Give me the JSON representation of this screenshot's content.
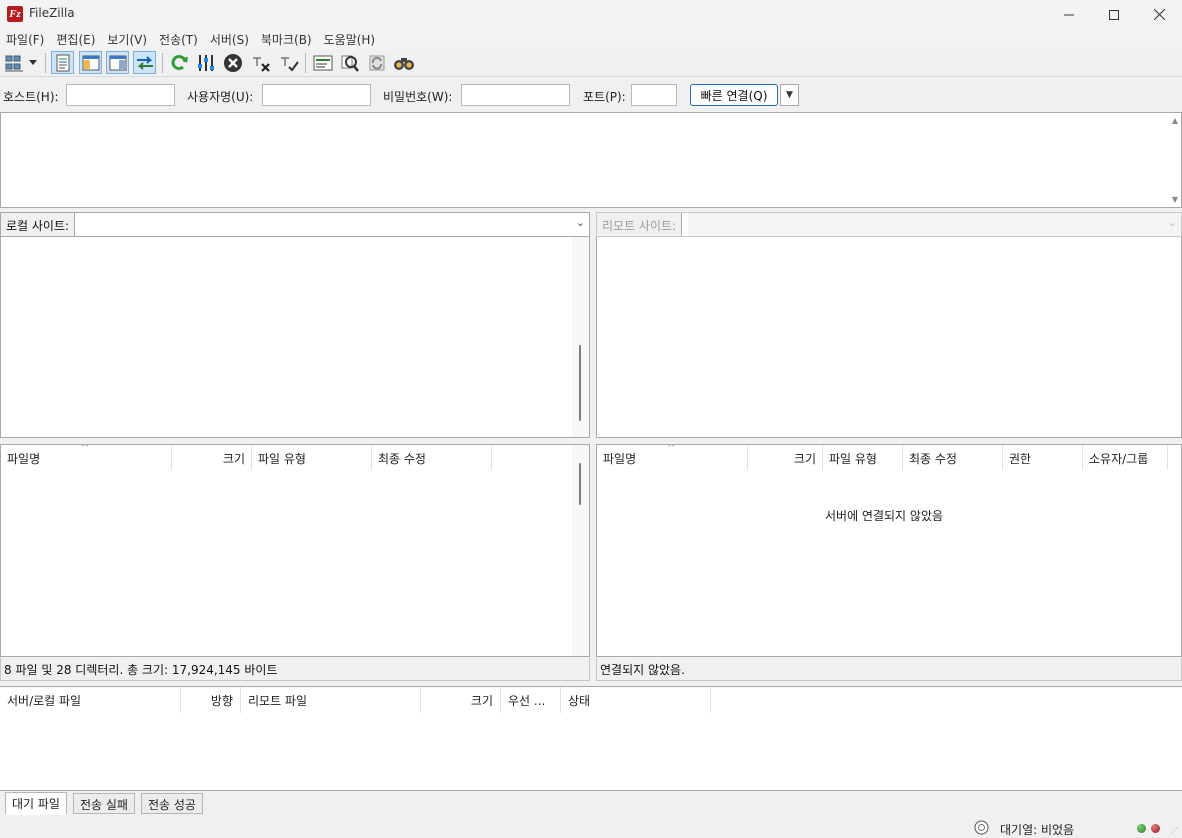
{
  "window": {
    "title": "FileZilla",
    "logo_text": "Fz"
  },
  "menu": [
    {
      "label": "파일(F)"
    },
    {
      "label": "편집(E)"
    },
    {
      "label": "보기(V)"
    },
    {
      "label": "전송(T)"
    },
    {
      "label": "서버(S)"
    },
    {
      "label": "북마크(B)"
    },
    {
      "label": "도움말(H)"
    }
  ],
  "toolbar": {
    "icons": [
      "site-manager-icon",
      "dropdown-icon",
      "toggle-log-icon",
      "toggle-local-tree-icon",
      "toggle-remote-tree-icon",
      "toggle-queue-icon",
      "refresh-icon",
      "filter-icon",
      "cancel-icon",
      "disconnect-icon",
      "reconnect-icon",
      "directory-listing-icon",
      "search-icon",
      "sync-browsing-icon",
      "find-files-icon"
    ]
  },
  "quickconnect": {
    "host_label": "호스트(H):",
    "user_label": "사용자명(U):",
    "pass_label": "비밀번호(W):",
    "port_label": "포트(P):",
    "host_value": "",
    "user_value": "",
    "pass_value": "",
    "port_value": "",
    "connect_label": "빠른 연결(Q)",
    "dropdown_glyph": "▼"
  },
  "local": {
    "site_label": "로컬 사이트:",
    "path": "",
    "columns": [
      {
        "label": "파일명"
      },
      {
        "label": "크기"
      },
      {
        "label": "파일 유형"
      },
      {
        "label": "최종 수정"
      }
    ],
    "status": "8 파일 및 28 디렉터리. 총 크기: 17,924,145 바이트"
  },
  "remote": {
    "site_label": "리모트 사이트:",
    "columns": [
      {
        "label": "파일명"
      },
      {
        "label": "크기"
      },
      {
        "label": "파일 유형"
      },
      {
        "label": "최종 수정"
      },
      {
        "label": "권한"
      },
      {
        "label": "소유자/그룹"
      }
    ],
    "empty_message": "서버에 연결되지 않았음",
    "status": "연결되지 않았음."
  },
  "queue": {
    "columns": [
      {
        "label": "서버/로컬 파일"
      },
      {
        "label": "방향"
      },
      {
        "label": "리모트 파일"
      },
      {
        "label": "크기"
      },
      {
        "label": "우선 ..."
      },
      {
        "label": "상태"
      }
    ],
    "tabs": [
      {
        "label": "대기 파일",
        "active": true
      },
      {
        "label": "전송 실패",
        "active": false
      },
      {
        "label": "전송 성공",
        "active": false
      }
    ]
  },
  "statusbar": {
    "queue_text": "대기열: 비었음",
    "indicators": {
      "transfer_up": "#2b7a2b",
      "transfer_down": "#8a1c1c"
    }
  },
  "colors": {
    "accent": "#1f6fc3",
    "brand": "#b71c1c"
  }
}
